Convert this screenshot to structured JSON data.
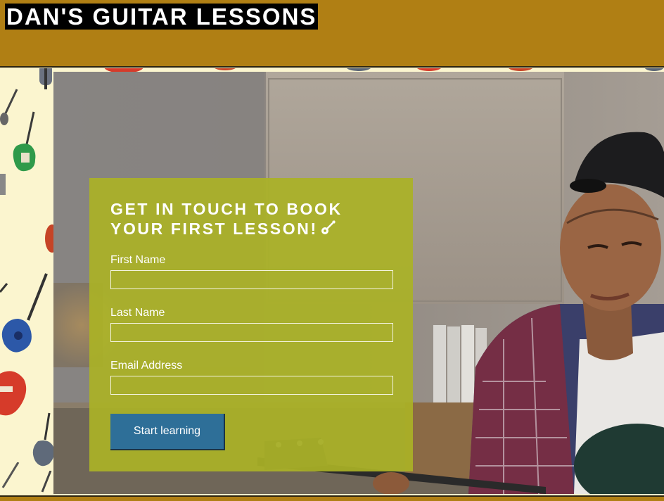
{
  "header": {
    "site_title": "DAN'S GUITAR LESSONS"
  },
  "form": {
    "heading": "GET IN TOUCH TO BOOK YOUR FIRST LESSON!",
    "heading_icon": "guitar-icon",
    "fields": [
      {
        "label": "First Name",
        "value": "",
        "placeholder": ""
      },
      {
        "label": "Last Name",
        "value": "",
        "placeholder": ""
      },
      {
        "label": "Email Address",
        "value": "",
        "placeholder": ""
      }
    ],
    "submit_label": "Start learning"
  },
  "colors": {
    "header_bg": "#b07f14",
    "title_bg": "#000000",
    "form_bg": "#aab226",
    "button_bg": "#2e6f98",
    "pattern_bg": "#fbf5cf"
  }
}
